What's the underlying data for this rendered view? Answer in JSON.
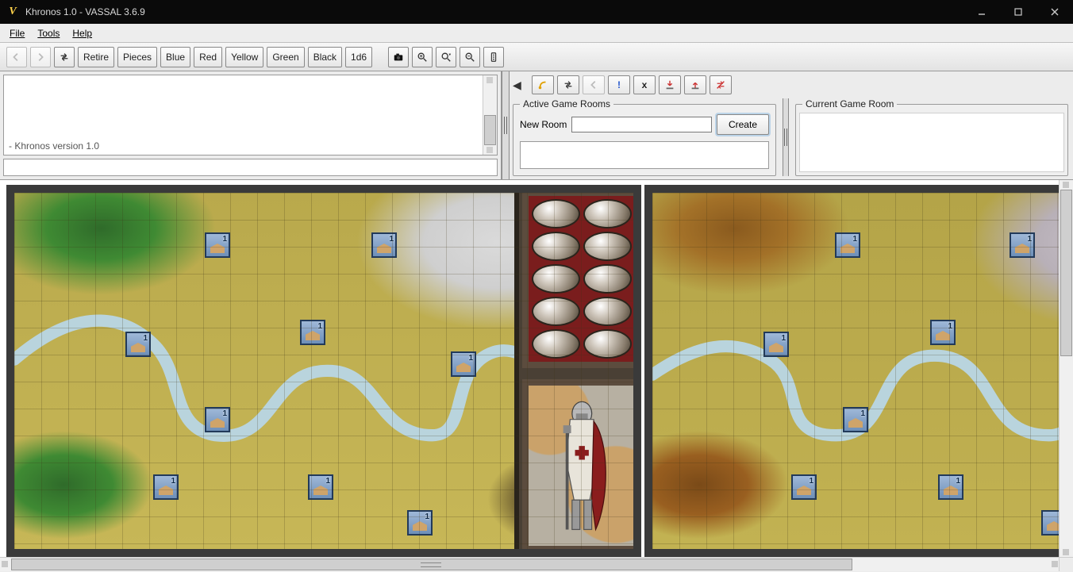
{
  "window": {
    "title": "Khronos 1.0 - VASSAL 3.6.9",
    "app_icon_glyph": "V"
  },
  "menu": {
    "file": "File",
    "tools": "Tools",
    "help": "Help"
  },
  "toolbar": {
    "retire": "Retire",
    "pieces": "Pieces",
    "blue": "Blue",
    "red": "Red",
    "yellow": "Yellow",
    "green": "Green",
    "black": "Black",
    "die": "1d6"
  },
  "log": {
    "last_line": "- Khronos version 1.0"
  },
  "rooms": {
    "active_legend": "Active Game Rooms",
    "current_legend": "Current Game Room",
    "new_room_label": "New Room",
    "new_room_value": "",
    "create_label": "Create"
  },
  "tokens": {
    "value_label": "1"
  }
}
